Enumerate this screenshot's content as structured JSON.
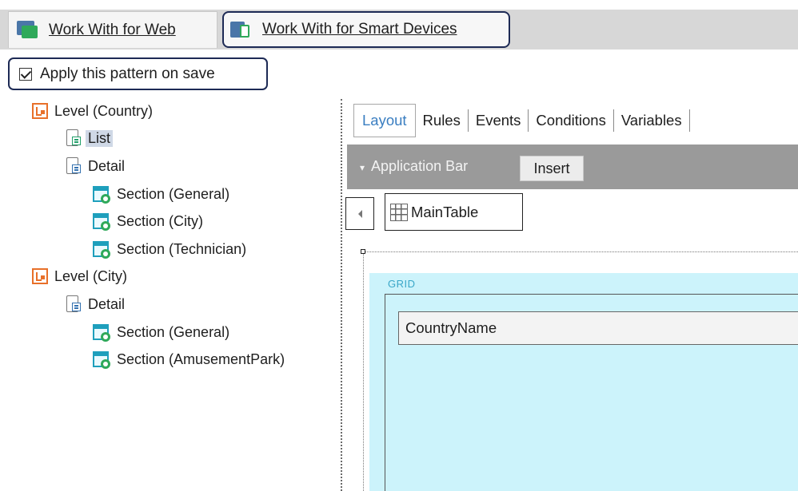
{
  "pattern_tabs": [
    {
      "label": "Work With for Web",
      "icon": "web-pattern-icon"
    },
    {
      "label": "Work With for Smart Devices",
      "icon": "smart-devices-pattern-icon"
    }
  ],
  "apply_checkbox": {
    "label": "Apply this pattern on save",
    "checked": true
  },
  "tree": [
    {
      "label": "Level (Country)",
      "icon": "level-icon"
    },
    {
      "label": "List",
      "icon": "list-device-icon",
      "selected": true
    },
    {
      "label": "Detail",
      "icon": "detail-device-icon"
    },
    {
      "label": "Section (General)",
      "icon": "section-icon"
    },
    {
      "label": "Section (City)",
      "icon": "section-icon"
    },
    {
      "label": "Section (Technician)",
      "icon": "section-icon"
    },
    {
      "label": "Level (City)",
      "icon": "level-icon"
    },
    {
      "label": "Detail",
      "icon": "detail-device-icon"
    },
    {
      "label": "Section (General)",
      "icon": "section-icon"
    },
    {
      "label": "Section (AmusementPark)",
      "icon": "section-icon"
    }
  ],
  "editor_tabs": [
    "Layout",
    "Rules",
    "Events",
    "Conditions",
    "Variables"
  ],
  "active_editor_tab": "Layout",
  "app_bar": {
    "title": "Application Bar",
    "insert_label": "Insert",
    "collapse_glyph": "▾"
  },
  "main_table": {
    "label": "MainTable"
  },
  "grid": {
    "label": "GRID",
    "field": "CountryName"
  },
  "colors": {
    "accent_border": "#1d2a55",
    "active_tab_text": "#3a7ec1",
    "level_icon": "#e8702a",
    "grid_bg": "#ccf3fb",
    "app_bar_bg": "#9a9a9a"
  }
}
